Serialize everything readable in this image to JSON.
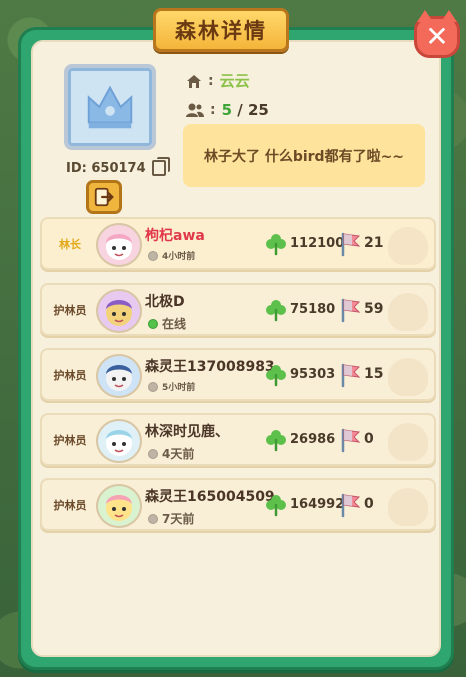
{
  "dialog": {
    "title": "森林详情",
    "close_label": "✕"
  },
  "forest": {
    "id_label": "ID: 650174",
    "name": "云云",
    "members_current": "5",
    "members_sep": " / ",
    "members_max": "25",
    "motto": "林子大了  什么bird都有了啦~~"
  },
  "icons": {
    "home": "home-icon",
    "members": "members-icon",
    "copy": "copy-icon",
    "exit": "exit-icon",
    "clover": "clover-icon",
    "flag": "flag-icon"
  },
  "colors": {
    "frame": "#2fa66f",
    "panel": "#f7f0dc",
    "title_tab": "#f4b53a",
    "close": "#f46a5a",
    "online": "#52c24a",
    "leader_name": "#e0384a",
    "leader_role": "#e2a818"
  },
  "members": [
    {
      "role": "林长",
      "name": "枸杞awa",
      "status": "4小时前",
      "online": false,
      "small_status": true,
      "clover": "112100",
      "flags": "21",
      "leader": true
    },
    {
      "role": "护林员",
      "name": "北极D",
      "status": "在线",
      "online": true,
      "small_status": false,
      "clover": "75180",
      "flags": "59",
      "leader": false
    },
    {
      "role": "护林员",
      "name": "森灵王137008983",
      "status": "5小时前",
      "online": false,
      "small_status": true,
      "clover": "95303",
      "flags": "15",
      "leader": false
    },
    {
      "role": "护林员",
      "name": "林深时见鹿、",
      "status": "4天前",
      "online": false,
      "small_status": false,
      "clover": "26986",
      "flags": "0",
      "leader": false
    },
    {
      "role": "护林员",
      "name": "森灵王165004509",
      "status": "7天前",
      "online": false,
      "small_status": false,
      "clover": "164992",
      "flags": "0",
      "leader": false
    }
  ]
}
